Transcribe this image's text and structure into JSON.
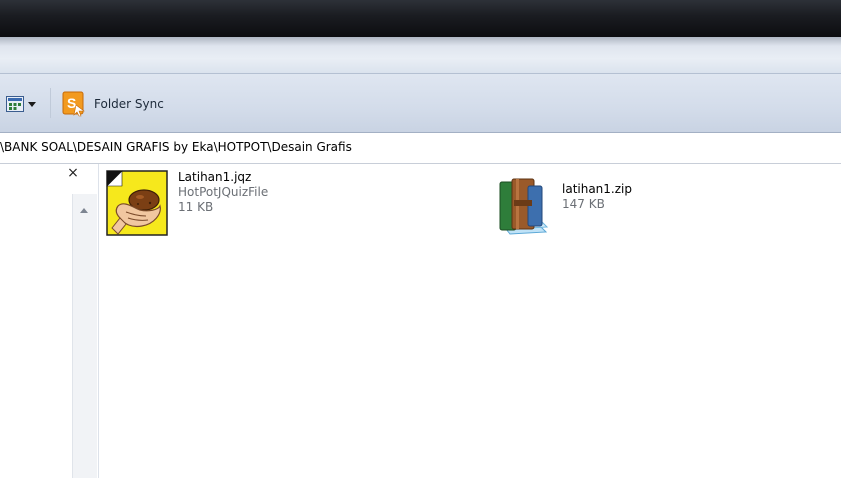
{
  "toolbar": {
    "view_icon": "change-view-icon",
    "view_dropdown_icon": "chevron-down-icon",
    "folder_sync": {
      "label": "Folder Sync",
      "icon": "folder-sync-icon"
    }
  },
  "address": {
    "path": "\\BANK SOAL\\DESAIN GRAFIS by Eka\\HOTPOT\\Desain Grafis"
  },
  "nav_pane": {
    "close_glyph": "×",
    "scroll_up_icon": "scroll-up-arrow-icon"
  },
  "files": [
    {
      "name": "Latihan1.jqz",
      "type": "HotPotJQuizFile",
      "size": "11 KB",
      "icon": "hotpotatoes-quiz-icon"
    },
    {
      "name": "latihan1.zip",
      "size": "147 KB",
      "icon": "zip-archive-icon"
    }
  ],
  "colors": {
    "toolbar_bg": "#d3dcea",
    "titlebar_bg": "#1a1c21",
    "subtext": "#6b6f75",
    "quiz_icon_yellow": "#f6e81c"
  }
}
